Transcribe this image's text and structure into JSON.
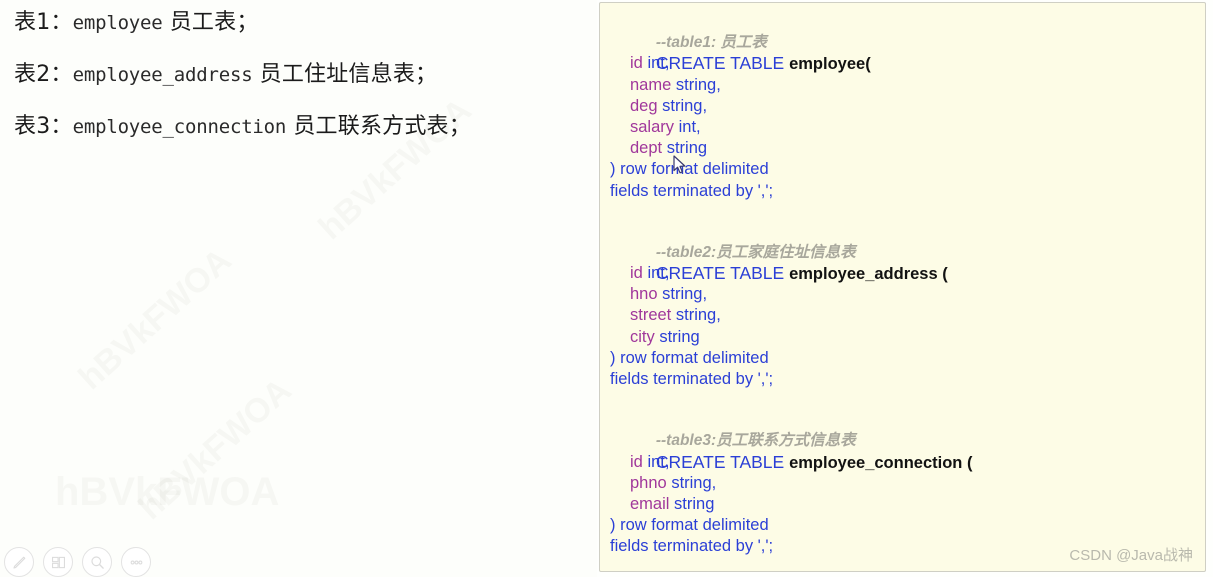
{
  "notes": {
    "lines": [
      {
        "prefix": "表1：",
        "mono": "employee",
        "suffix": " 员工表；"
      },
      {
        "prefix": "表2：",
        "mono": "employee_address",
        "suffix": " 员工住址信息表；"
      },
      {
        "prefix": "表3：",
        "mono": "employee_connection",
        "suffix": " 员工联系方式表；"
      }
    ]
  },
  "code_panel": {
    "background_color": "#fdfce6",
    "border_color": "#cfcfc4",
    "colors": {
      "comment": "#a8a79c",
      "keyword": "#2b3fd6",
      "identifier": "#121212",
      "column": "#a0379b",
      "type": "#2b3fd6"
    },
    "blocks": [
      {
        "comment": "--table1: 员工表",
        "create_keyword": "CREATE TABLE ",
        "table_name": "employee(",
        "columns": [
          {
            "name": "id",
            "type": "int,"
          },
          {
            "name": "name",
            "type": "string,"
          },
          {
            "name": "deg",
            "type": "string,"
          },
          {
            "name": "salary",
            "type": "int,"
          },
          {
            "name": "dept",
            "type": "string"
          }
        ],
        "row_format": ") row format delimited",
        "fields_terminated": "fields terminated by ',';"
      },
      {
        "comment": "--table2:员工家庭住址信息表",
        "create_keyword": "CREATE TABLE ",
        "table_name": "employee_address (",
        "columns": [
          {
            "name": "id",
            "type": "int,"
          },
          {
            "name": "hno",
            "type": "string,"
          },
          {
            "name": "street",
            "type": "string,"
          },
          {
            "name": "city",
            "type": "string"
          }
        ],
        "row_format": ") row format delimited",
        "fields_terminated": "fields terminated by ',';"
      },
      {
        "comment": "--table3:员工联系方式信息表",
        "create_keyword": "CREATE TABLE ",
        "table_name": "employee_connection (",
        "columns": [
          {
            "name": "id",
            "type": "int,"
          },
          {
            "name": "phno",
            "type": "string,"
          },
          {
            "name": "email",
            "type": "string"
          }
        ],
        "row_format": ") row format delimited",
        "fields_terminated": "fields terminated by ',';"
      }
    ]
  },
  "watermark": {
    "text": "hBVkFWOA"
  },
  "credit": {
    "text": "CSDN @Java战神"
  },
  "toolbar": {
    "items": [
      {
        "icon": "pen-icon",
        "label": "编辑"
      },
      {
        "icon": "layout-icon",
        "label": "布局"
      },
      {
        "icon": "search-icon",
        "label": "搜索"
      },
      {
        "icon": "more-icon",
        "label": "更多"
      }
    ]
  }
}
